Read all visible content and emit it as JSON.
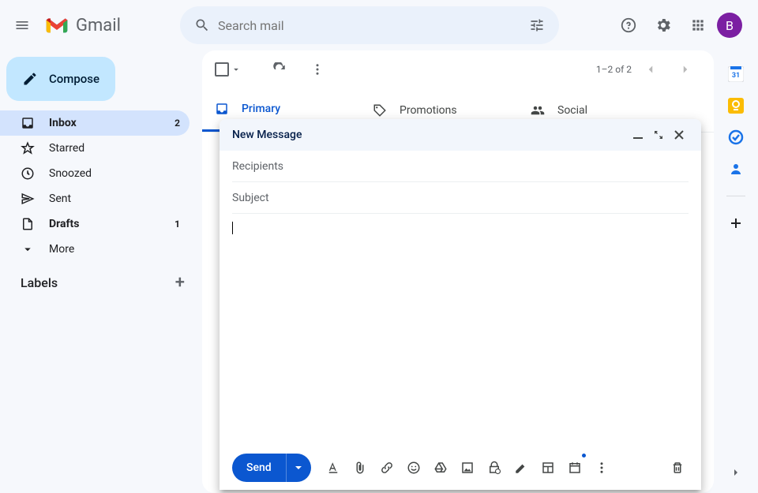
{
  "header": {
    "app_name": "Gmail",
    "search_placeholder": "Search mail",
    "avatar_initial": "B"
  },
  "sidebar": {
    "compose_label": "Compose",
    "items": [
      {
        "label": "Inbox",
        "count": "2",
        "active": true,
        "bold": true,
        "icon": "inbox"
      },
      {
        "label": "Starred",
        "icon": "star"
      },
      {
        "label": "Snoozed",
        "icon": "clock"
      },
      {
        "label": "Sent",
        "icon": "send"
      },
      {
        "label": "Drafts",
        "count": "1",
        "bold": true,
        "icon": "draft"
      },
      {
        "label": "More",
        "icon": "chevron-down"
      }
    ],
    "labels_header": "Labels"
  },
  "toolbar": {
    "pagination": "1–2 of 2"
  },
  "tabs": [
    {
      "label": "Primary",
      "active": true
    },
    {
      "label": "Promotions"
    },
    {
      "label": "Social"
    }
  ],
  "compose": {
    "title": "New Message",
    "recipients_placeholder": "Recipients",
    "subject_placeholder": "Subject",
    "send_label": "Send"
  },
  "right_panel_date": "31"
}
